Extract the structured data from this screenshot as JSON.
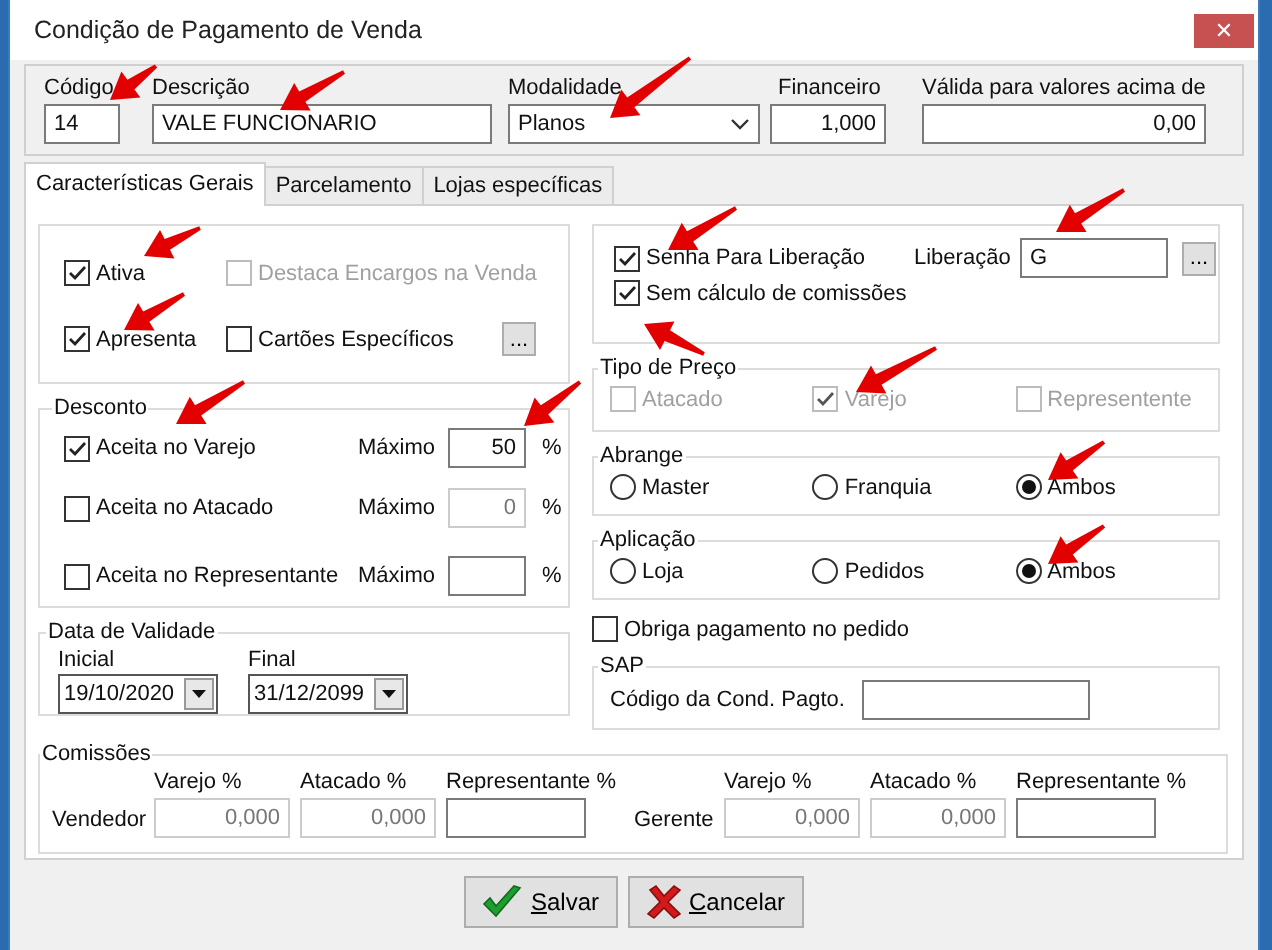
{
  "window": {
    "title": "Condição de Pagamento de Venda",
    "close": "✕"
  },
  "header_fields": [
    {
      "label": "Código",
      "value": "14",
      "kind": "text"
    },
    {
      "label": "Descrição",
      "value": "VALE FUNCIONARIO",
      "kind": "text"
    },
    {
      "label": "Modalidade",
      "value": "Planos",
      "kind": "select"
    },
    {
      "label": "Financeiro",
      "value": "1,000",
      "kind": "number"
    },
    {
      "label": "Válida para valores acima de",
      "value": "0,00",
      "kind": "number"
    }
  ],
  "tabs": [
    {
      "label": "Características Gerais",
      "selected": true
    },
    {
      "label": "Parcelamento",
      "selected": false
    },
    {
      "label": "Lojas específicas",
      "selected": false
    }
  ],
  "general_options": [
    {
      "label": "Ativa",
      "checked": true,
      "disabled": false
    },
    {
      "label": "Destaca  Encargos na Venda",
      "checked": false,
      "disabled": true
    },
    {
      "label": "Apresenta",
      "checked": true,
      "disabled": false
    },
    {
      "label": "Cartões Específicos",
      "checked": false,
      "disabled": false
    }
  ],
  "general_button": "...",
  "desconto": {
    "title": "Desconto",
    "rows": [
      {
        "label": "Aceita no Varejo",
        "checked": true,
        "max_label": "Máximo",
        "value": "50",
        "disabled": false,
        "unit": "%"
      },
      {
        "label": "Aceita no Atacado",
        "checked": false,
        "max_label": "Máximo",
        "value": "0",
        "disabled": true,
        "unit": "%"
      },
      {
        "label": "Aceita no Representante",
        "checked": false,
        "max_label": "Máximo",
        "disabled": false,
        "unit": "%"
      }
    ]
  },
  "validade": {
    "title": "Data de Validade",
    "fields": [
      {
        "label": "Inicial",
        "value": "19/10/2020"
      },
      {
        "label": "Final",
        "value": "31/12/2099"
      }
    ]
  },
  "liberacao": {
    "options": [
      {
        "label": "Senha Para Liberação",
        "checked": true
      },
      {
        "label": "Sem cálculo de comissões",
        "checked": true
      }
    ],
    "label": "Liberação",
    "value": "G",
    "button": "..."
  },
  "tipo_de_preco": {
    "title": "Tipo de Preço",
    "options": [
      {
        "label": "Atacado",
        "checked": false,
        "disabled": true
      },
      {
        "label": "Varejo",
        "checked": true,
        "disabled": true
      },
      {
        "label": "Representente",
        "checked": false,
        "disabled": true
      }
    ]
  },
  "abrange": {
    "title": "Abrange",
    "options": [
      {
        "label": "Master",
        "selected": false
      },
      {
        "label": "Franquia",
        "selected": false
      },
      {
        "label": "Ambos",
        "selected": true
      }
    ]
  },
  "aplicacao": {
    "title": "Aplicação",
    "options": [
      {
        "label": "Loja",
        "selected": false
      },
      {
        "label": "Pedidos",
        "selected": false
      },
      {
        "label": "Ambos",
        "selected": true
      }
    ]
  },
  "obriga": {
    "label": "Obriga pagamento no pedido",
    "checked": false
  },
  "sap": {
    "title": "SAP",
    "label": "Código da Cond. Pagto."
  },
  "comissoes": {
    "title": "Comissões",
    "groups": [
      {
        "label": "Vendedor",
        "columns": [
          {
            "header": "Varejo %",
            "value": "0,000",
            "disabled": true
          },
          {
            "header": "Atacado %",
            "value": "0,000",
            "disabled": true
          },
          {
            "header": "Representante %",
            "disabled": false
          }
        ]
      },
      {
        "label": "Gerente",
        "columns": [
          {
            "header": "Varejo %",
            "value": "0,000",
            "disabled": true
          },
          {
            "header": "Atacado %",
            "value": "0,000",
            "disabled": true
          },
          {
            "header": "Representante %",
            "disabled": false
          }
        ]
      }
    ]
  },
  "buttons": [
    {
      "label": "Salvar",
      "kind": "save"
    },
    {
      "label": "Cancelar",
      "kind": "cancel"
    }
  ]
}
